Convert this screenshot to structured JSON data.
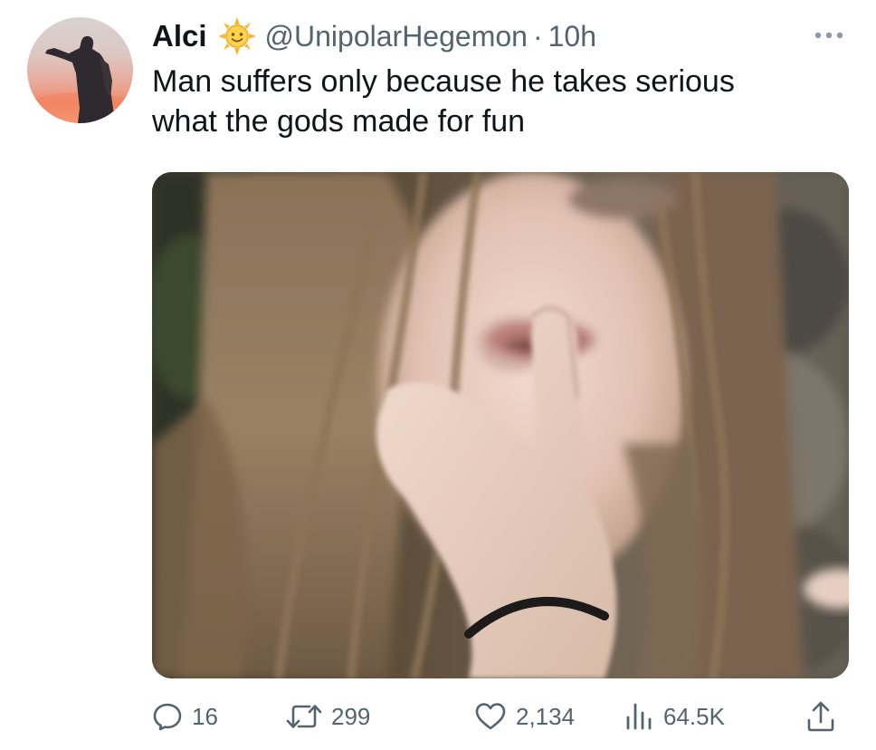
{
  "tweet": {
    "display_name": "Alci",
    "name_emoji": "sun-with-face-emoji",
    "handle": "@UnipolarHegemon",
    "separator": "·",
    "time": "10h",
    "text": "Man suffers only because he takes serious\nwhat the gods made for fun",
    "avatar": "statue-silhouette-sunset-avatar",
    "media": "blurry-photo-woman-hand-on-mouth"
  },
  "actions": {
    "replies": "16",
    "reposts": "299",
    "likes": "2,134",
    "views": "64.5K"
  },
  "icons": {
    "more": "more-horizontal-icon",
    "reply": "reply-icon",
    "repost": "repost-icon",
    "like": "heart-icon",
    "views": "views-bar-chart-icon",
    "share": "share-icon"
  },
  "colors": {
    "text_primary": "#0f1419",
    "text_secondary": "#536471"
  }
}
